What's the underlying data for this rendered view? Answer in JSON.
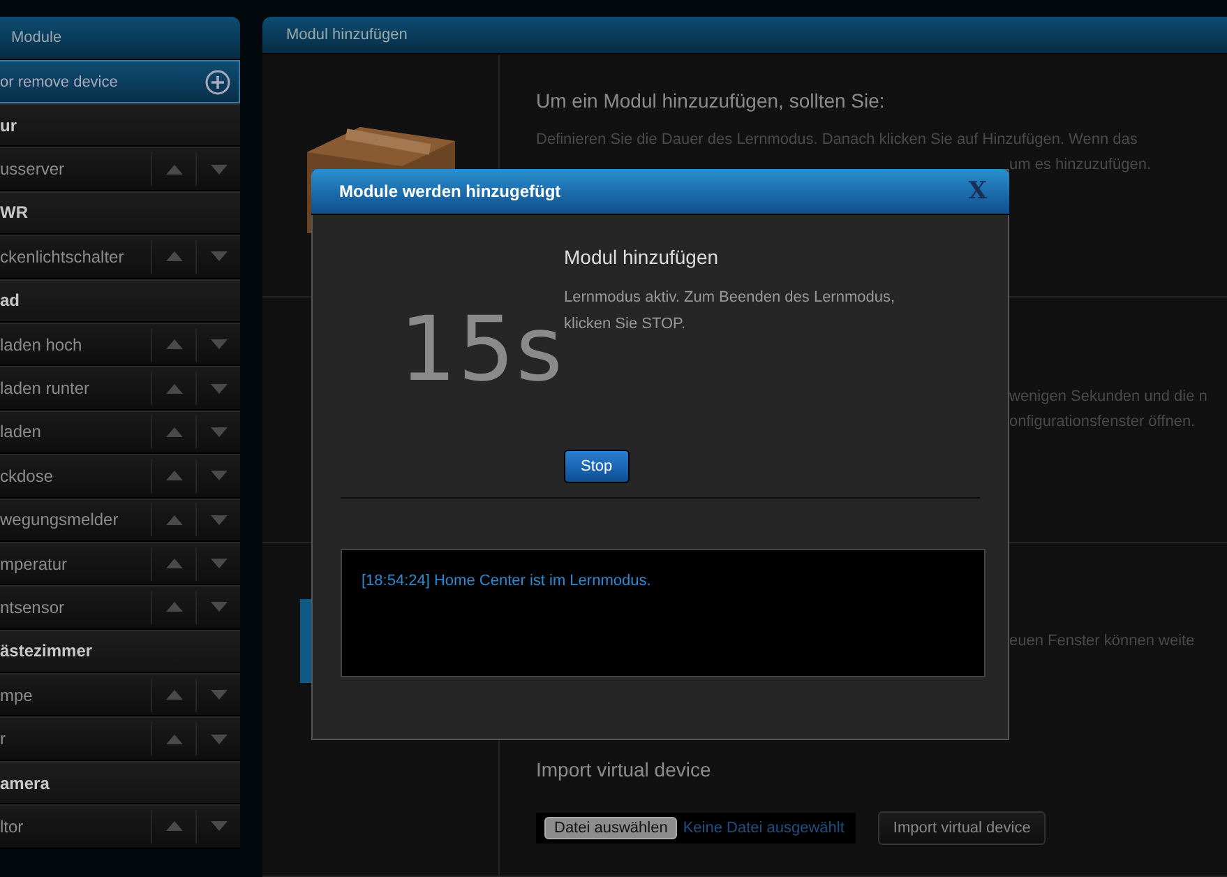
{
  "sidebar": {
    "title": "Module",
    "add_button": "or remove device",
    "items": [
      {
        "kind": "room",
        "label": "ur"
      },
      {
        "kind": "device",
        "label": "usserver"
      },
      {
        "kind": "room",
        "label": "WR"
      },
      {
        "kind": "device",
        "label": "ckenlichtschalter"
      },
      {
        "kind": "room",
        "label": "ad"
      },
      {
        "kind": "device",
        "label": "laden hoch"
      },
      {
        "kind": "device",
        "label": "laden runter"
      },
      {
        "kind": "device",
        "label": "laden"
      },
      {
        "kind": "device",
        "label": "ckdose"
      },
      {
        "kind": "device",
        "label": "wegungsmelder"
      },
      {
        "kind": "device",
        "label": "mperatur"
      },
      {
        "kind": "device",
        "label": "ntsensor"
      },
      {
        "kind": "room",
        "label": "ästezimmer"
      },
      {
        "kind": "device",
        "label": "mpe"
      },
      {
        "kind": "device",
        "label": "r"
      },
      {
        "kind": "room",
        "label": "amera"
      },
      {
        "kind": "device",
        "label": "ltor"
      }
    ]
  },
  "panel": {
    "title": "Modul hinzufügen",
    "intro": {
      "heading": "Um ein Modul hinzuzufügen, sollten Sie:",
      "line": "Definieren Sie die Dauer des Lernmodus. Danach klicken Sie auf Hinzufügen. Wenn das",
      "fragment": "um es hinzuzufügen."
    },
    "learn": {
      "fragments": [
        "wenigen Sekunden und die n",
        "onfigurationsfenster öffnen."
      ]
    },
    "window": {
      "fragment": "euen Fenster können weite"
    },
    "import": {
      "heading": "Import virtual device",
      "file_button": "Datei auswählen",
      "file_status": "Keine Datei ausgewählt",
      "button": "Import virtual device"
    }
  },
  "dialog": {
    "title": "Module werden hinzugefügt",
    "close": "X",
    "countdown": "15s",
    "heading": "Modul hinzufügen",
    "message": "Lernmodus aktiv. Zum Beenden des Lernmodus, klicken Sie STOP.",
    "stop_button": "Stop",
    "log": [
      "[18:54:24] Home Center ist im Lernmodus."
    ]
  }
}
